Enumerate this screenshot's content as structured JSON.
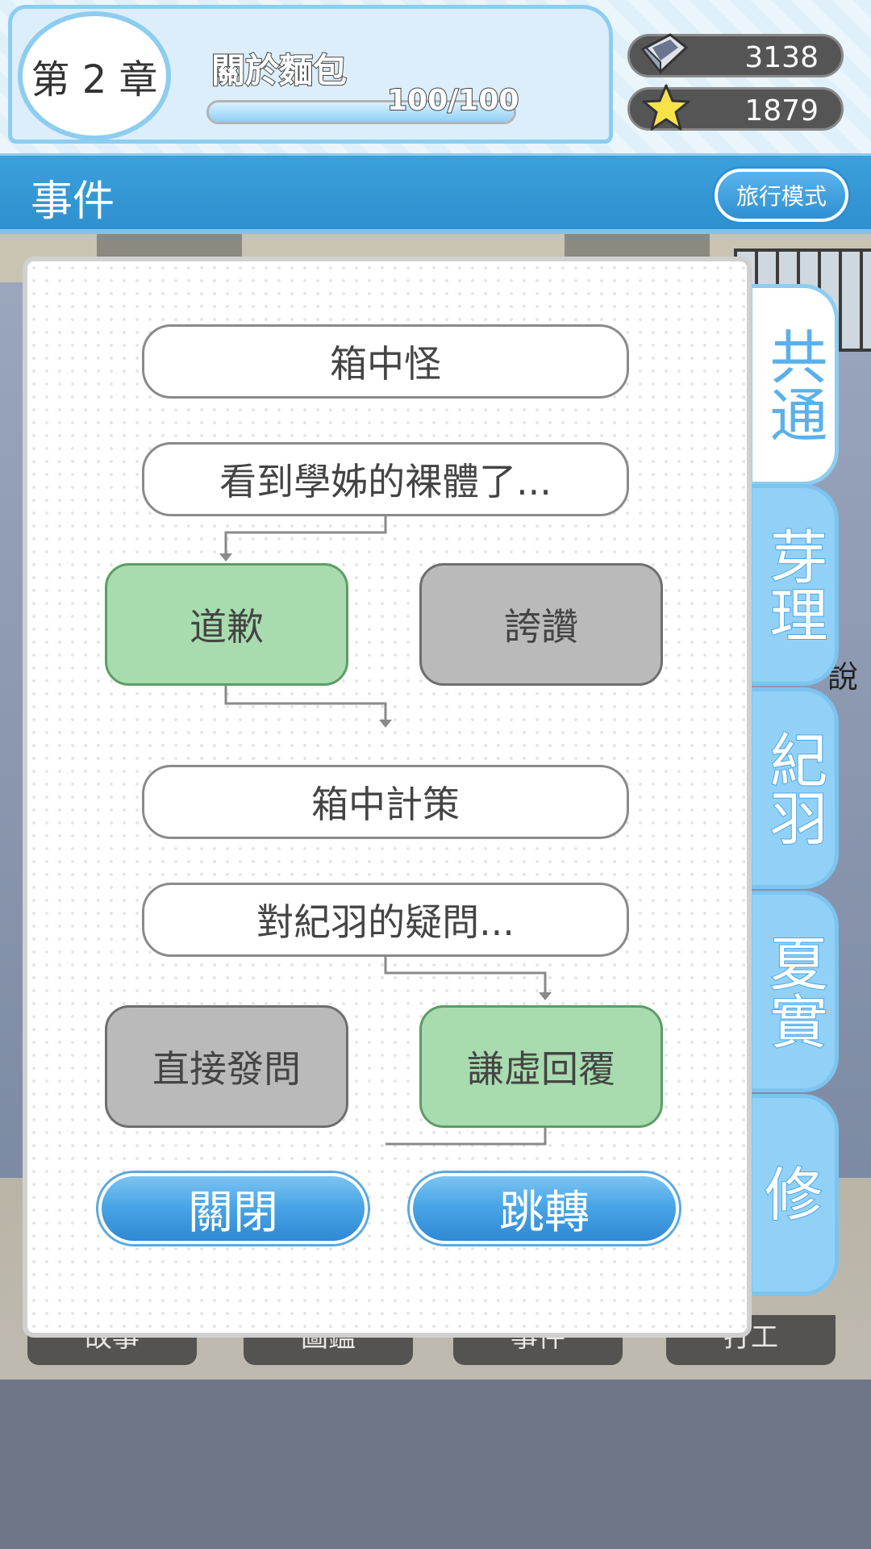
{
  "header": {
    "chapter_label": "第 2 章",
    "chapter_title": "關於麵包",
    "progress_text": "100/100",
    "progress_fraction": 1.0
  },
  "currencies": [
    {
      "icon": "gem-icon",
      "value": "3138"
    },
    {
      "icon": "star-icon",
      "value": "1879"
    }
  ],
  "titlebar": {
    "title": "事件",
    "travel_mode_label": "旅行模式"
  },
  "events": {
    "nodes": {
      "n1": "箱中怪",
      "n2": "看到學姊的裸體了...",
      "choice1_a": "道歉",
      "choice1_b": "誇讚",
      "n3": "箱中計策",
      "n4": "對紀羽的疑問...",
      "choice2_a": "直接發問",
      "choice2_b": "謙虛回覆"
    },
    "selected": [
      "choice1_a",
      "choice2_b"
    ],
    "close_label": "關閉",
    "jump_label": "跳轉"
  },
  "side_tabs": [
    {
      "label": "共通",
      "active": true
    },
    {
      "label": "芽理",
      "active": false
    },
    {
      "label": "紀羽",
      "active": false
    },
    {
      "label": "夏實",
      "active": false
    },
    {
      "label": "修",
      "active": false
    }
  ],
  "background": {
    "bottom_tabs": [
      "故事",
      "圖鑑",
      "事件",
      "打工"
    ],
    "sign_text": "說"
  },
  "colors": {
    "accent_blue": "#3aa0db",
    "selected_green": "#a8dcaf",
    "unselected_gray": "#bababa"
  }
}
